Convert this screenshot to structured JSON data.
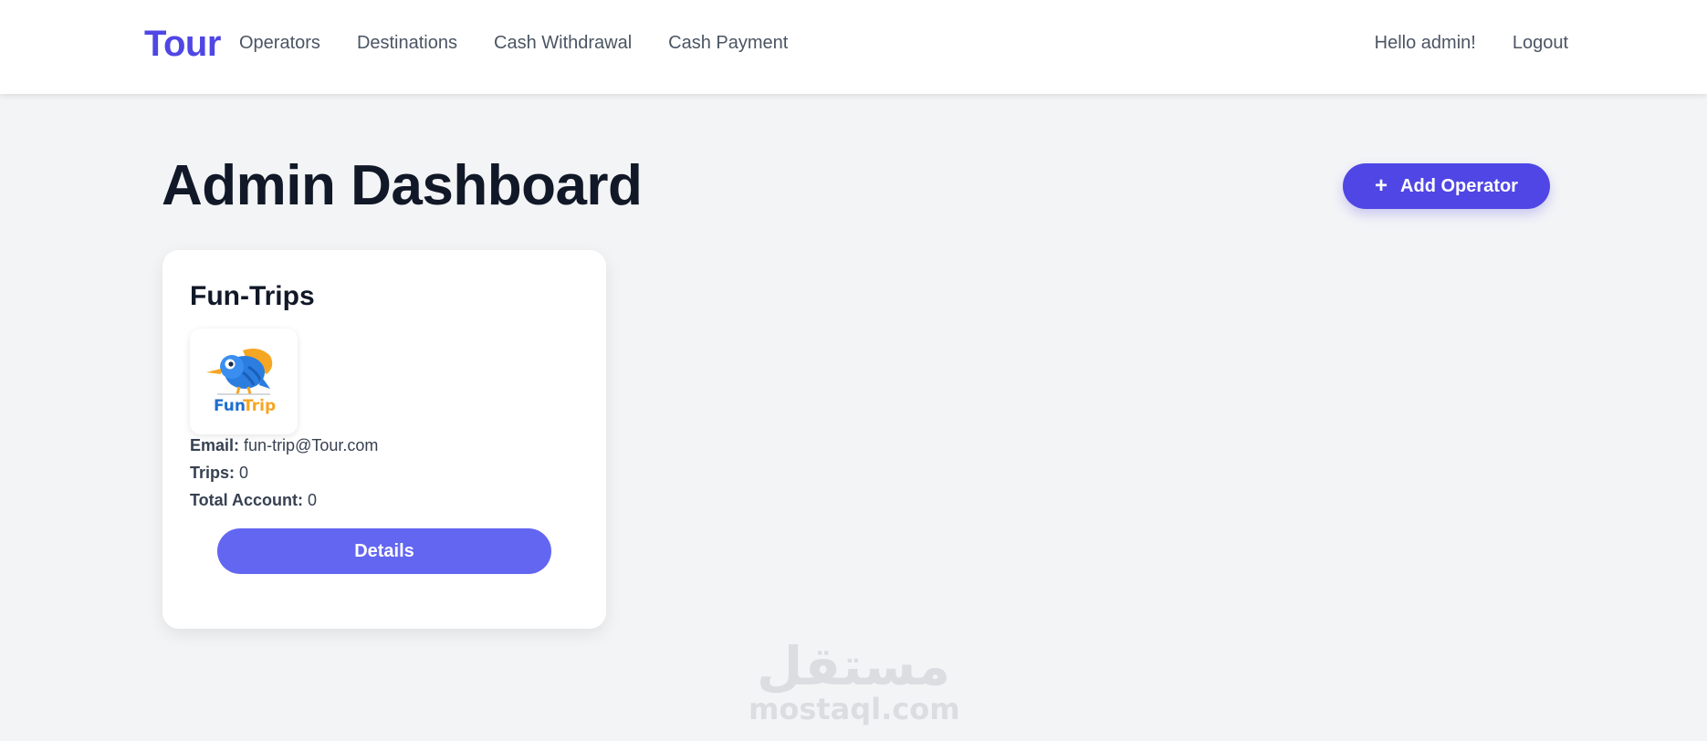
{
  "navbar": {
    "brand": "Tour",
    "links": [
      "Operators",
      "Destinations",
      "Cash Withdrawal",
      "Cash Payment"
    ],
    "greeting": "Hello admin!",
    "logout": "Logout"
  },
  "page": {
    "title": "Admin Dashboard",
    "add_button_icon": "plus-icon",
    "add_button_label": "Add Operator"
  },
  "operators": [
    {
      "name": "Fun-Trips",
      "logo_text_part1": "Fun",
      "logo_text_part2": "Trip",
      "email_label": "Email:",
      "email": "fun-trip@Tour.com",
      "trips_label": "Trips:",
      "trips": "0",
      "total_account_label": "Total Account:",
      "total_account": "0",
      "details_label": "Details"
    }
  ],
  "watermark": {
    "arabic": "مستقل",
    "latin": "mostaql.com"
  },
  "colors": {
    "brand": "#4f46e5",
    "primary_button": "#4f46e5",
    "details_button": "#6366f1",
    "background": "#f3f4f6",
    "logo_blue": "#1e6fd0",
    "logo_orange": "#f5a623"
  }
}
